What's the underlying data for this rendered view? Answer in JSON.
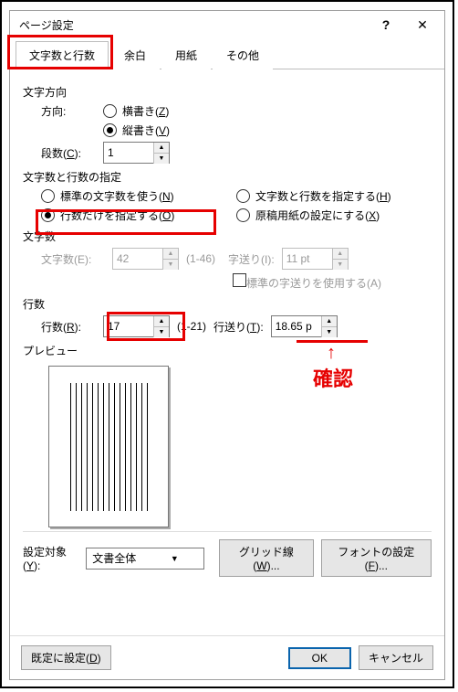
{
  "window": {
    "title": "ページ設定",
    "help": "?",
    "close": "✕"
  },
  "tabs": {
    "t0": "文字数と行数",
    "t1": "余白",
    "t2": "用紙",
    "t3": "その他"
  },
  "s1": {
    "title": "文字方向",
    "dir_label": "方向:",
    "horiz": "横書き(",
    "horiz_k": "Z",
    "vert": "縦書き(",
    "vert_k": "V",
    "close": ")",
    "cols_label": "段数(",
    "cols_k": "C",
    "cols_val": "1"
  },
  "s2": {
    "title": "文字数と行数の指定",
    "o0": "標準の文字数を使う(",
    "o0k": "N",
    "o1": "文字数と行数を指定する(",
    "o1k": "H",
    "o2": "行数だけを指定する(",
    "o2k": "O",
    "o3": "原稿用紙の設定にする(",
    "o3k": "X",
    "close": ")"
  },
  "s3": {
    "title": "文字数",
    "chars_label": "文字数(E):",
    "chars_val": "42",
    "chars_range": "(1-46)",
    "pitch_label": "字送り(I):",
    "pitch_val": "11 pt",
    "chk": "標準の字送りを使用する(A)"
  },
  "s4": {
    "title": "行数",
    "lines_label": "行数(",
    "lines_k": "R",
    "lines_val": "17",
    "lines_range": "(1-21)",
    "lpitch_label": "行送り(",
    "lpitch_k": "T",
    "lpitch_val": "18.65 p"
  },
  "s5": {
    "title": "プレビュー"
  },
  "s6": {
    "target_label": "設定対象(",
    "target_k": "Y",
    "target_val": "文書全体",
    "grid": "グリッド線(",
    "grid_k": "W",
    "grid_suf": ")...",
    "font": "フォントの設定(",
    "font_k": "F",
    "font_suf": ")..."
  },
  "footer": {
    "default": "既定に設定(",
    "default_k": "D",
    "ok": "OK",
    "cancel": "キャンセル"
  },
  "annot": {
    "confirm": "確認"
  }
}
